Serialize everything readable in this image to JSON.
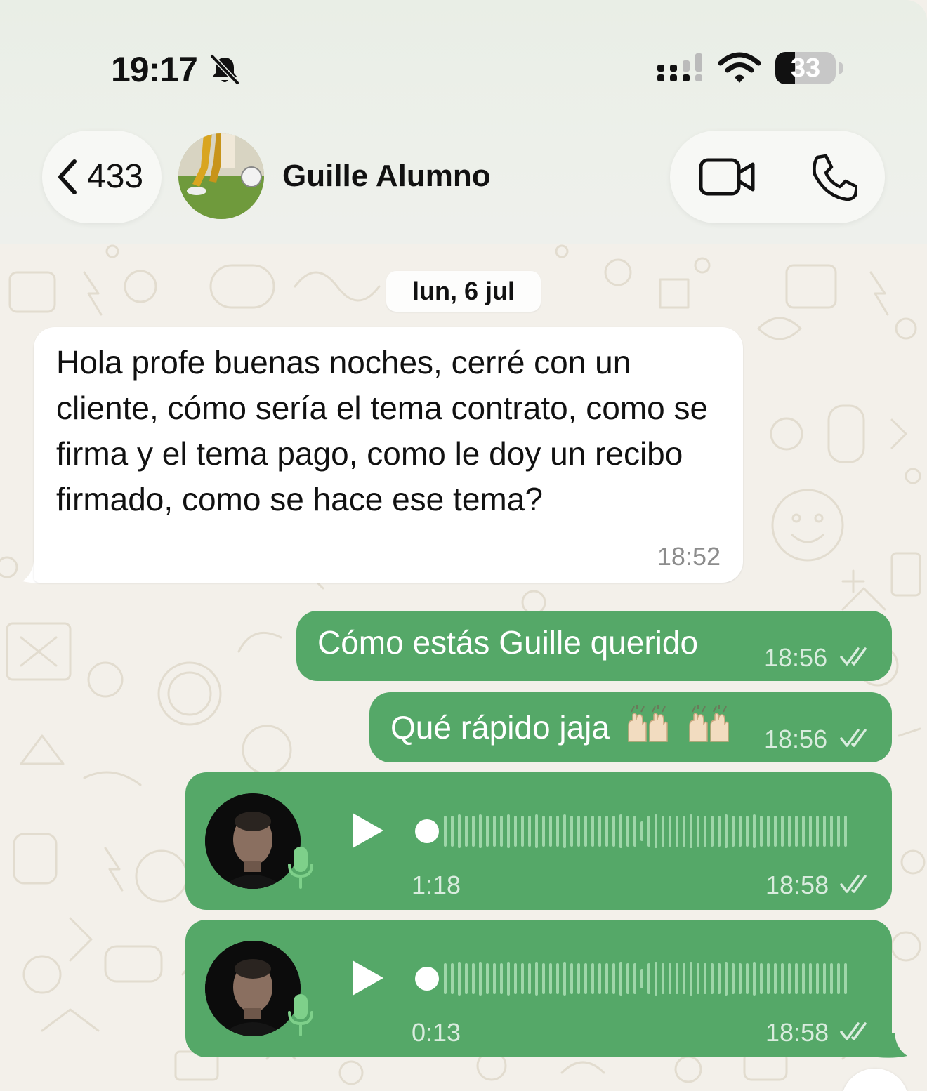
{
  "status_bar": {
    "time": "19:17",
    "battery_level": "33",
    "icons": [
      "bell-slash-icon",
      "cellular-signal-icon",
      "wifi-icon",
      "battery-icon"
    ]
  },
  "header": {
    "back_count": "433",
    "contact_name": "Guille Alumno",
    "icons": [
      "chevron-left-icon",
      "video-call-icon",
      "phone-call-icon"
    ]
  },
  "chat": {
    "date_separator": "lun, 6 jul",
    "messages": [
      {
        "direction": "incoming",
        "text": "Hola profe buenas noches, cerré con un cliente, cómo sería el tema contrato, como se firma y el tema pago, como le doy un recibo firmado, como se hace ese tema?",
        "time": "18:52"
      },
      {
        "direction": "outgoing",
        "text": "Cómo estás Guille querido",
        "time": "18:56",
        "status": "read"
      },
      {
        "direction": "outgoing",
        "text": "Qué rápido jaja",
        "emoji": "raising-hands",
        "time": "18:56",
        "status": "read"
      },
      {
        "direction": "outgoing",
        "type": "voice",
        "duration": "1:18",
        "time": "18:58",
        "status": "read"
      },
      {
        "direction": "outgoing",
        "type": "voice",
        "duration": "0:13",
        "time": "18:58",
        "status": "read"
      }
    ]
  },
  "colors": {
    "outgoing_bubble": "#55a868",
    "incoming_bubble": "#ffffff",
    "wallpaper": "#f3f0ea",
    "header_bg": "#edf0ea"
  }
}
